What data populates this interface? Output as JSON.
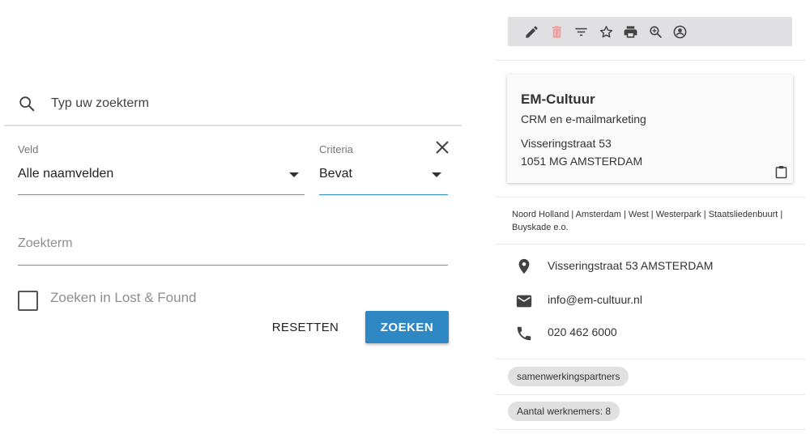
{
  "search": {
    "placeholder": "Typ uw zoekterm"
  },
  "filter": {
    "field_label": "Veld",
    "field_value": "Alle naamvelden",
    "criteria_label": "Criteria",
    "criteria_value": "Bevat",
    "term_placeholder": "Zoekterm",
    "lost_found_label": "Zoeken in Lost & Found",
    "lost_found_checked": false
  },
  "actions": {
    "reset_label": "RESETTEN",
    "search_label": "ZOEKEN"
  },
  "toolbar": {
    "icons": [
      "pencil-icon",
      "trash-icon",
      "filter-icon",
      "star-icon",
      "print-icon",
      "zoom-in-icon",
      "account-circle-icon"
    ]
  },
  "contact": {
    "name": "EM-Cultuur",
    "subtitle": "CRM en e-mailmarketing",
    "address_line1": "Visseringstraat 53",
    "address_line2": "1051 MG AMSTERDAM",
    "region": "Noord Holland | Amsterdam | West | Westerpark | Staatsliedenbuurt | Buyskade e.o.",
    "location": "Visseringstraat 53 AMSTERDAM",
    "email": "info@em-cultuur.nl",
    "phone": "020 462 6000",
    "tags": [
      "samenwerkingspartners",
      "Aantal werknemers: 8"
    ]
  },
  "colors": {
    "primary_button": "#2f87c3",
    "toolbar_bg": "#e0e0e2",
    "trash_icon": "#ef9a9a"
  }
}
